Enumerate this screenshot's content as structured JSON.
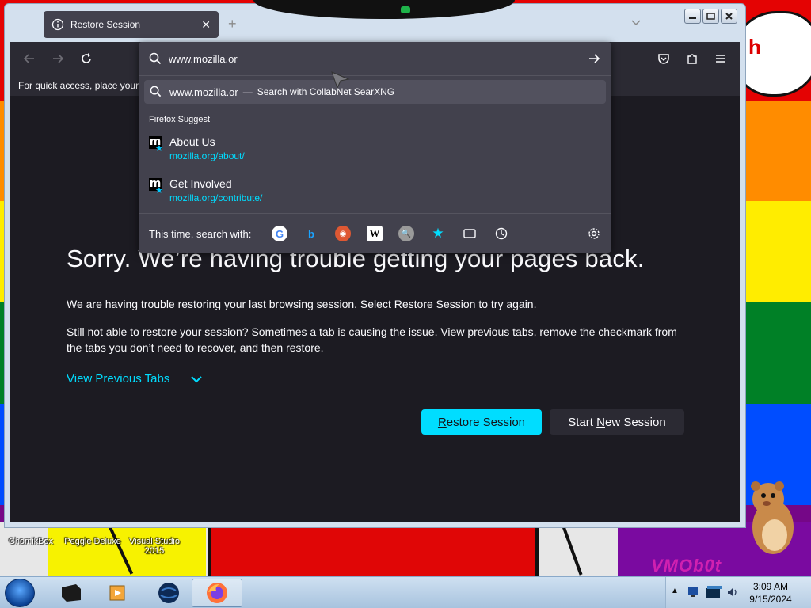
{
  "browser": {
    "tab_title": "Restore Session",
    "bookmarks_toolbar_message": "For quick access, place your b",
    "urlbar": {
      "value": "www.mozilla.or",
      "search_suggestion": {
        "query": "www.mozilla.or",
        "separator": "—",
        "label": "Search with CollabNet SearXNG"
      },
      "suggest_heading": "Firefox Suggest",
      "results": [
        {
          "title": "About Us",
          "url": "mozilla.org/about/",
          "favicon": "mozilla-m-icon"
        },
        {
          "title": "Get Involved",
          "url": "mozilla.org/contribute/",
          "favicon": "mozilla-m-icon"
        }
      ],
      "search_with_label": "This time, search with:",
      "engines": [
        "google-icon",
        "bing-icon",
        "duckduckgo-icon",
        "wikipedia-icon",
        "searxng-icon",
        "bookmarks-star-icon",
        "tabs-icon",
        "history-icon"
      ]
    }
  },
  "page": {
    "title": "Sorry. We’re having trouble getting your pages back.",
    "paragraph_1": "We are having trouble restoring your last browsing session. Select Restore Session to try again.",
    "paragraph_2": "Still not able to restore your session? Sometimes a tab is causing the issue. View previous tabs, remove the checkmark from the tabs you don’t need to recover, and then restore.",
    "view_previous_tabs": "View Previous Tabs",
    "restore_button": {
      "mnemonic": "R",
      "rest": "estore Session"
    },
    "new_session_button": {
      "before": "Start ",
      "mnemonic": "N",
      "after": "ew Session"
    }
  },
  "desktop": {
    "icons": [
      {
        "label": "ChomikBox"
      },
      {
        "label": "Peggle Deluxe"
      },
      {
        "label": "Visual Studio 2015"
      }
    ],
    "speech_text": "h",
    "watermark": "VMOb0t"
  },
  "taskbar": {
    "clock_time": "3:09 AM",
    "clock_date": "9/15/2024"
  },
  "colors": {
    "accent": "#00ddff",
    "page_bg": "#1c1b22",
    "panel_bg": "#42414d"
  }
}
